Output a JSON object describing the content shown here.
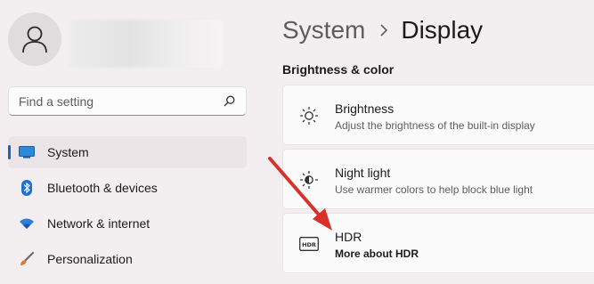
{
  "sidebar": {
    "search_placeholder": "Find a setting",
    "items": [
      {
        "label": "System",
        "icon": "monitor-icon",
        "selected": true
      },
      {
        "label": "Bluetooth & devices",
        "icon": "bluetooth-icon",
        "selected": false
      },
      {
        "label": "Network & internet",
        "icon": "wifi-icon",
        "selected": false
      },
      {
        "label": "Personalization",
        "icon": "brush-icon",
        "selected": false
      }
    ]
  },
  "header": {
    "parent": "System",
    "current": "Display"
  },
  "main": {
    "section_title": "Brightness & color",
    "cards": [
      {
        "title": "Brightness",
        "description": "Adjust the brightness of the built-in display",
        "icon": "sun-icon"
      },
      {
        "title": "Night light",
        "description": "Use warmer colors to help block blue light",
        "icon": "night-light-icon"
      },
      {
        "title": "HDR",
        "link": "More about HDR",
        "icon": "hdr-icon"
      }
    ]
  },
  "colors": {
    "accent": "#1d5fbb",
    "annotation_arrow": "#d9302c"
  }
}
